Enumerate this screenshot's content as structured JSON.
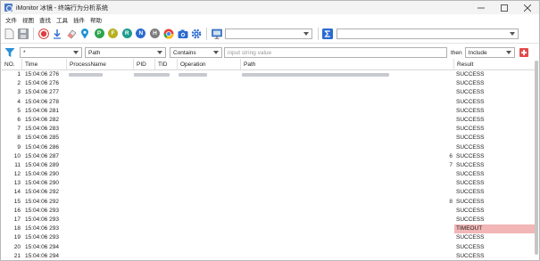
{
  "window": {
    "title": "iMonitor 冰镜 - 终端行为分析系统"
  },
  "menu": [
    "文件",
    "视图",
    "查找",
    "工具",
    "插件",
    "帮助"
  ],
  "toolbar": {
    "circle_buttons": [
      {
        "name": "p-button",
        "letter": "P",
        "color": "#2ea44f"
      },
      {
        "name": "f-button",
        "letter": "F",
        "color": "#b7b020"
      },
      {
        "name": "r-button",
        "letter": "R",
        "color": "#1e9c8c"
      },
      {
        "name": "n-button",
        "letter": "N",
        "color": "#2a6bd1"
      },
      {
        "name": "h-button",
        "letter": "H",
        "color": "#7d7d7d"
      }
    ],
    "combo1_value": "",
    "combo2_value": ""
  },
  "filter": {
    "field1_value": "*",
    "field2_value": "Path",
    "operator_value": "Contains",
    "input_placeholder": "input string value",
    "then_label": "then",
    "action_value": "Include"
  },
  "table": {
    "headers": [
      "NO.",
      "Time",
      "ProcessName",
      "PID",
      "TID",
      "Operation",
      "Path",
      "Result"
    ],
    "rows": [
      {
        "no": "1",
        "time": "15:04:06 276",
        "path": "",
        "result": "SUCCESS"
      },
      {
        "no": "2",
        "time": "15:04:06 276",
        "path": "",
        "result": "SUCCESS"
      },
      {
        "no": "3",
        "time": "15:04:06 277",
        "path": "",
        "result": "SUCCESS"
      },
      {
        "no": "4",
        "time": "15:04:06 278",
        "path": "",
        "result": "SUCCESS"
      },
      {
        "no": "5",
        "time": "15:04:06 281",
        "path": "",
        "result": "SUCCESS"
      },
      {
        "no": "6",
        "time": "15:04:06 282",
        "path": "",
        "result": "SUCCESS"
      },
      {
        "no": "7",
        "time": "15:04:06 283",
        "path": "",
        "result": "SUCCESS"
      },
      {
        "no": "8",
        "time": "15:04:06 285",
        "path": "",
        "result": "SUCCESS"
      },
      {
        "no": "9",
        "time": "15:04:06 286",
        "path": "",
        "result": "SUCCESS"
      },
      {
        "no": "10",
        "time": "15:04:06 287",
        "path": "6",
        "result": "SUCCESS"
      },
      {
        "no": "11",
        "time": "15:04:06 289",
        "path": "7",
        "result": "SUCCESS"
      },
      {
        "no": "12",
        "time": "15:04:06 290",
        "path": "",
        "result": "SUCCESS"
      },
      {
        "no": "13",
        "time": "15:04:06 290",
        "path": "",
        "result": "SUCCESS"
      },
      {
        "no": "14",
        "time": "15:04:06 292",
        "path": "",
        "result": "SUCCESS"
      },
      {
        "no": "15",
        "time": "15:04:06 292",
        "path": "8",
        "result": "SUCCESS"
      },
      {
        "no": "16",
        "time": "15:04:06 293",
        "path": "",
        "result": "SUCCESS"
      },
      {
        "no": "17",
        "time": "15:04:06 293",
        "path": "",
        "result": "SUCCESS"
      },
      {
        "no": "18",
        "time": "15:04:06 293",
        "path": "",
        "result": "TIMEOUT"
      },
      {
        "no": "19",
        "time": "15:04:06 293",
        "path": "",
        "result": "SUCCESS"
      },
      {
        "no": "20",
        "time": "15:04:06 294",
        "path": "",
        "result": "SUCCESS"
      },
      {
        "no": "21",
        "time": "15:04:06 294",
        "path": "",
        "result": "SUCCESS"
      }
    ]
  },
  "colors": {
    "timeout_bg": "#f2b6b6",
    "accent_blue": "#2a6bd1"
  }
}
